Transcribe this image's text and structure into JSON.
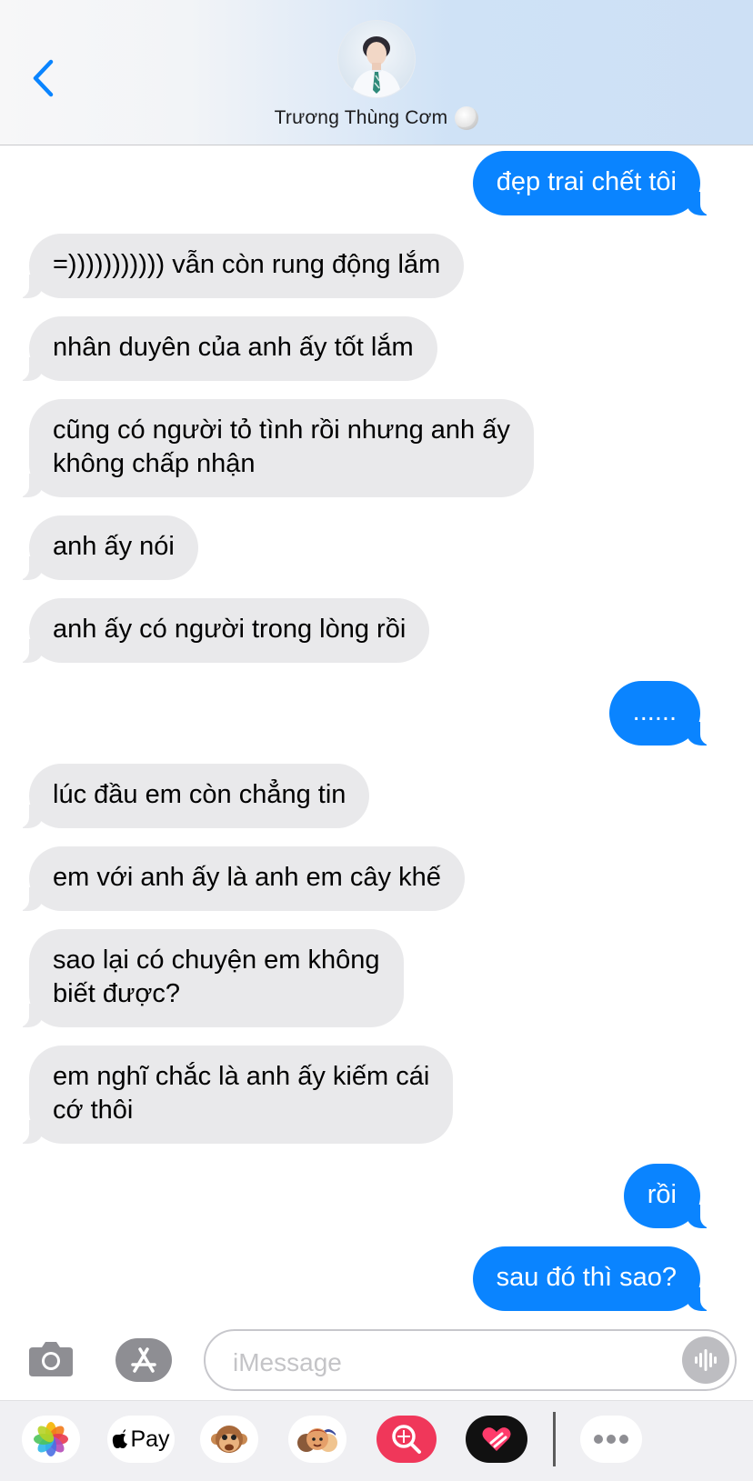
{
  "header": {
    "contact_name": "Trương Thùng Cơm",
    "back_icon": "chevron-left-icon",
    "avatar": "contact-avatar-photo",
    "status_emoji": "moon-emoji"
  },
  "messages": [
    {
      "side": "out",
      "text": "đẹp trai chết tôi"
    },
    {
      "side": "in",
      "text": "=))))))))))) vẫn còn rung động lắm"
    },
    {
      "side": "in",
      "text": "nhân duyên của anh ấy tốt lắm"
    },
    {
      "side": "in",
      "text": "cũng có người tỏ tình rồi nhưng anh ấy\nkhông chấp nhận"
    },
    {
      "side": "in",
      "text": "anh ấy nói"
    },
    {
      "side": "in",
      "text": "anh ấy có người trong lòng rồi"
    },
    {
      "side": "out",
      "text": "......"
    },
    {
      "side": "in",
      "text": "lúc đầu em còn chẳng tin"
    },
    {
      "side": "in",
      "text": "em với anh ấy là anh em cây khế"
    },
    {
      "side": "in",
      "text": "sao lại có chuyện em không\nbiết được?"
    },
    {
      "side": "in",
      "text": "em nghĩ chắc là anh ấy kiếm cái\ncớ thôi"
    },
    {
      "side": "out",
      "text": "rồi"
    },
    {
      "side": "out",
      "text": "sau đó thì sao?"
    }
  ],
  "compose": {
    "placeholder": "iMessage",
    "camera_icon": "camera-icon",
    "apps_icon": "app-store-icon",
    "audio_icon": "waveform-icon"
  },
  "drawer": {
    "apps": [
      {
        "name": "photos-icon"
      },
      {
        "name": "apple-pay-icon",
        "label": "Pay"
      },
      {
        "name": "animoji-icon"
      },
      {
        "name": "memoji-icon"
      },
      {
        "name": "images-search-icon"
      },
      {
        "name": "digital-touch-icon"
      },
      {
        "name": "more-icon"
      }
    ]
  },
  "colors": {
    "outgoing": "#0a84ff",
    "incoming": "#e9e9eb",
    "accent": "#0a84ff"
  }
}
